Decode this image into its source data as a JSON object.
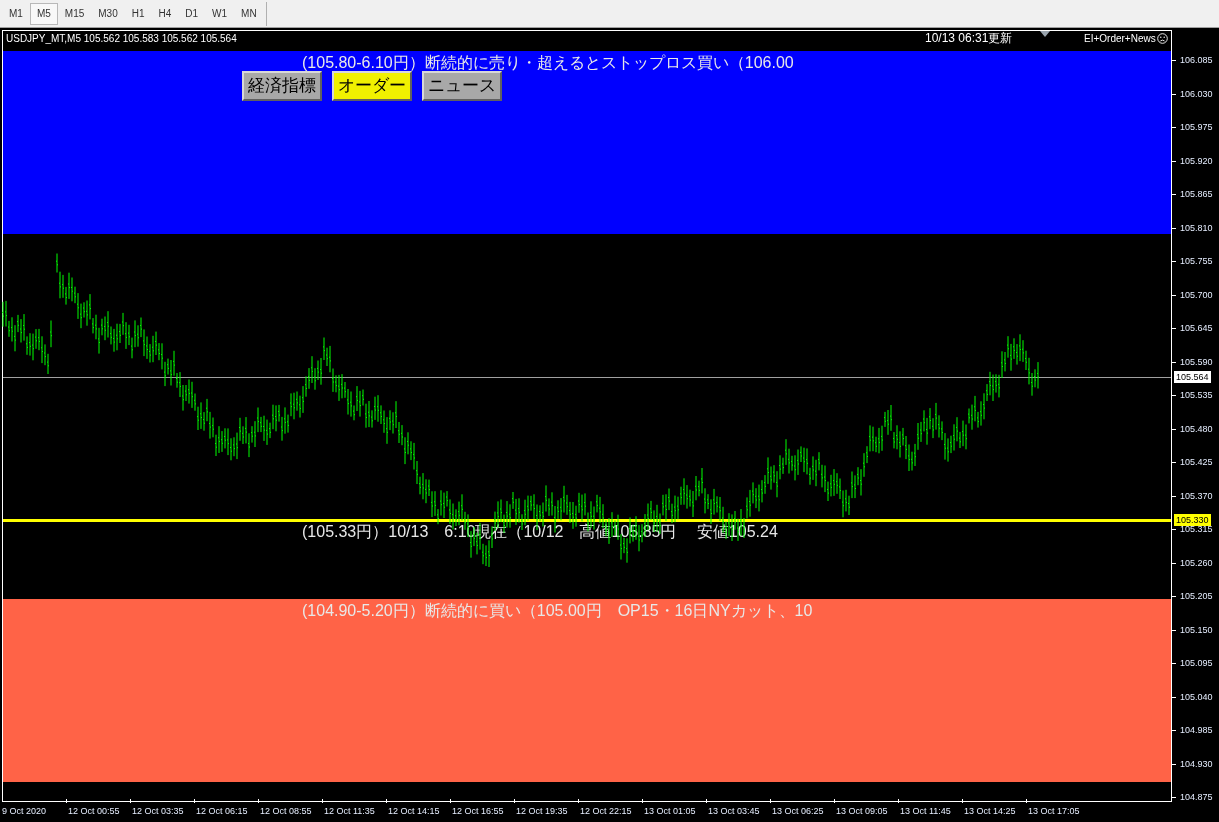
{
  "timeframes": [
    {
      "label": "M1",
      "selected": false
    },
    {
      "label": "M5",
      "selected": true
    },
    {
      "label": "M15",
      "selected": false
    },
    {
      "label": "M30",
      "selected": false
    },
    {
      "label": "H1",
      "selected": false
    },
    {
      "label": "H4",
      "selected": false
    },
    {
      "label": "D1",
      "selected": false
    },
    {
      "label": "W1",
      "selected": false
    },
    {
      "label": "MN",
      "selected": false
    }
  ],
  "chart": {
    "symbol_info": "USDJPY_MT,M5  105.562 105.583 105.562 105.564",
    "updated": "10/13 06:31更新",
    "indicator": "EI+Order+News",
    "buttons": [
      {
        "label": "経済指標",
        "selected": false
      },
      {
        "label": "オーダー",
        "selected": true
      },
      {
        "label": "ニュース",
        "selected": false
      }
    ],
    "zones": [
      {
        "kind": "band",
        "color": "#0000ff",
        "text": "(105.80-6.10円）断続的に売り・超えるとストップロス買い（106.00"
      },
      {
        "kind": "line",
        "color": "#ffff00",
        "text": "(105.33円）10/13　6:10現在（10/12　高値105.85円　 安値105.24",
        "price": "105.330"
      },
      {
        "kind": "band",
        "color": "#ff6347",
        "text": "(104.90-5.20円）断続的に買い（105.00円　OP15・16日NYカット、10"
      }
    ],
    "current_price": "105.564",
    "price_axis": [
      "106.085",
      "106.030",
      "105.975",
      "105.920",
      "105.865",
      "105.810",
      "105.755",
      "105.700",
      "105.645",
      "105.590",
      "105.535",
      "105.480",
      "105.425",
      "105.370",
      "105.315",
      "105.260",
      "105.205",
      "105.150",
      "105.095",
      "105.040",
      "104.985",
      "104.930",
      "104.875"
    ],
    "time_axis": [
      "9 Oct 2020",
      "12 Oct 00:55",
      "12 Oct 03:35",
      "12 Oct 06:15",
      "12 Oct 08:55",
      "12 Oct 11:35",
      "12 Oct 14:15",
      "12 Oct 16:55",
      "12 Oct 19:35",
      "12 Oct 22:15",
      "13 Oct 01:05",
      "13 Oct 03:45",
      "13 Oct 06:25",
      "13 Oct 09:05",
      "13 Oct 11:45",
      "13 Oct 14:25",
      "13 Oct 17:05"
    ]
  }
}
